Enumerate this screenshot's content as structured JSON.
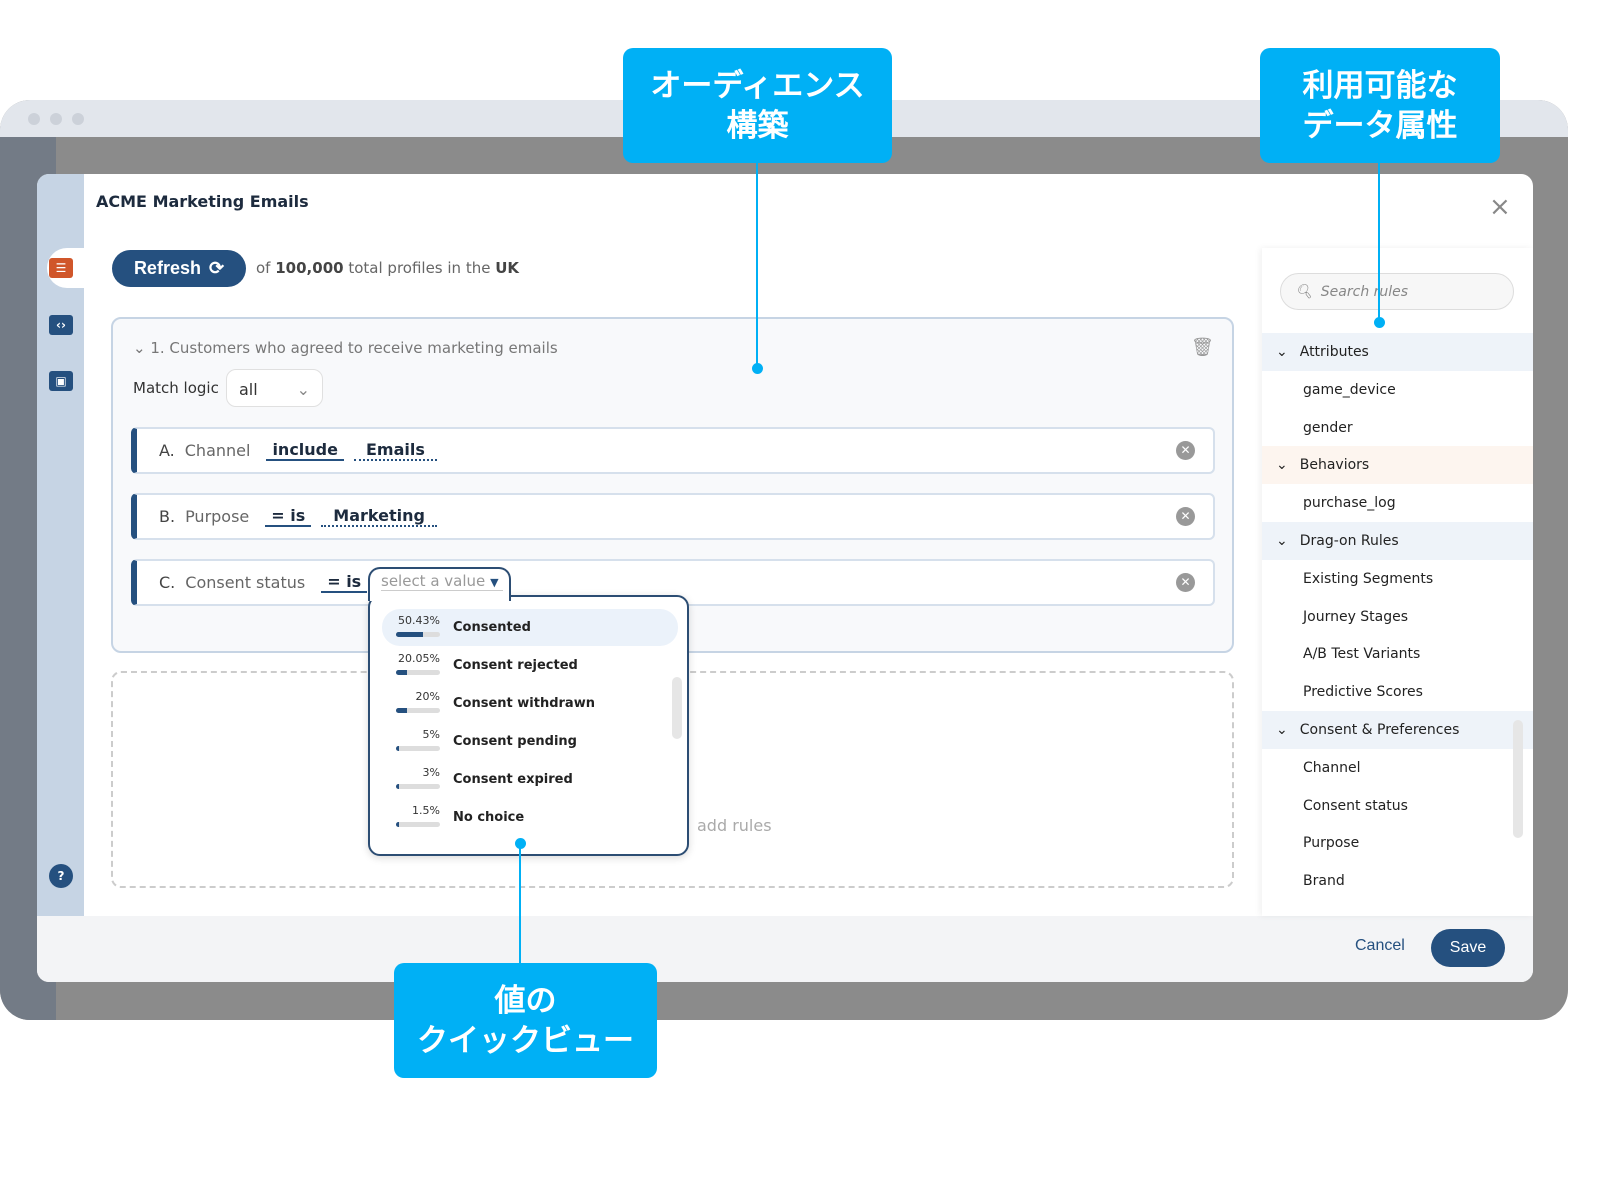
{
  "modal": {
    "title_brand": "ACME",
    "title": "Marketing Emails",
    "refresh_label": "Refresh",
    "total_prefix": "of",
    "total_count": "100,000",
    "total_mid": "total profiles in the",
    "total_region": "UK",
    "group": {
      "title": "1. Customers who agreed to receive marketing emails",
      "match_logic_label": "Match logic",
      "match_logic_value": "all",
      "rules": [
        {
          "key": "A.",
          "label": "Channel",
          "operator": "include",
          "value": "Emails"
        },
        {
          "key": "B.",
          "label": "Purpose",
          "operator": "= is",
          "value": "Marketing"
        },
        {
          "key": "C.",
          "label": "Consent status",
          "operator": "= is",
          "value": ""
        }
      ]
    },
    "value_placeholder": "select a value",
    "drop_hint": "add rules",
    "value_options": [
      {
        "percent": "50.43%",
        "fraction": 0.5043,
        "label": "Consented"
      },
      {
        "percent": "20.05%",
        "fraction": 0.2005,
        "label": "Consent rejected"
      },
      {
        "percent": "20%",
        "fraction": 0.2,
        "label": "Consent withdrawn"
      },
      {
        "percent": "5%",
        "fraction": 0.05,
        "label": "Consent pending"
      },
      {
        "percent": "3%",
        "fraction": 0.03,
        "label": "Consent expired"
      },
      {
        "percent": "1.5%",
        "fraction": 0.015,
        "label": "No choice"
      }
    ],
    "search_placeholder": "Search rules",
    "tree": [
      {
        "type": "h",
        "label": "Attributes"
      },
      {
        "type": "c",
        "label": "game_device"
      },
      {
        "type": "c",
        "label": "gender"
      },
      {
        "type": "h",
        "label": "Behaviors"
      },
      {
        "type": "c",
        "label": "purchase_log"
      },
      {
        "type": "h",
        "label": "Drag-on Rules"
      },
      {
        "type": "c",
        "label": "Existing Segments"
      },
      {
        "type": "c",
        "label": "Journey Stages"
      },
      {
        "type": "c",
        "label": "A/B Test Variants"
      },
      {
        "type": "c",
        "label": "Predictive Scores"
      },
      {
        "type": "h",
        "label": "Consent & Preferences"
      },
      {
        "type": "c",
        "label": "Channel"
      },
      {
        "type": "c",
        "label": "Consent status"
      },
      {
        "type": "c",
        "label": "Purpose"
      },
      {
        "type": "c",
        "label": "Brand"
      }
    ],
    "cancel_label": "Cancel",
    "save_label": "Save"
  },
  "callouts": {
    "audience": [
      "オーディエンス",
      "構築"
    ],
    "attributes": [
      "利用可能な",
      "データ属性"
    ],
    "quickview": [
      "値の",
      "クイックビュー"
    ]
  },
  "colors": {
    "primary": "#25507f",
    "callout": "#00b0f5",
    "rail": "#c6d4e4"
  }
}
